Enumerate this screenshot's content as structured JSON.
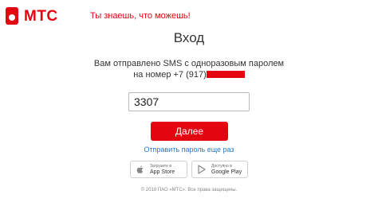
{
  "header": {
    "logo_text": "МТС",
    "slogan": "Ты знаешь, что можешь!",
    "brand_color": "#e30611"
  },
  "main": {
    "title": "Вход",
    "message_line1": "Вам отправлено SMS с одноразовым паролем",
    "message_line2_prefix": "на номер +7 (917)",
    "code_value": "3307",
    "next_label": "Далее",
    "resend_label": "Отправить пароль еще раз",
    "link_color": "#2b78c5"
  },
  "stores": {
    "apple": {
      "small": "Загрузите в",
      "big": "App Store",
      "icon": "apple-icon"
    },
    "google": {
      "small": "Доступно в",
      "big": "Google Play",
      "icon": "google-play-icon"
    }
  },
  "footer": {
    "copyright": "© 2018 ПАО «МТС». Все права защищены."
  }
}
